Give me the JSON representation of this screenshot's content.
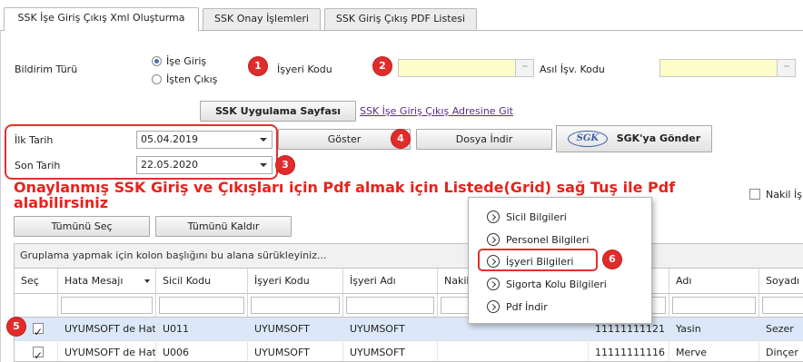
{
  "tabs": [
    {
      "label": "SSK İşe Giriş Çıkış Xml Oluşturma",
      "active": true
    },
    {
      "label": "SSK Onay İşlemleri",
      "active": false
    },
    {
      "label": "SSK Giriş Çıkış PDF Listesi",
      "active": false
    }
  ],
  "form": {
    "bildirim_label": "Bildirim Türü",
    "radio_ise_giris": "İşe Giriş",
    "radio_isten_cikis": "İşten Çıkış",
    "selected_radio": "İşe Giriş",
    "isyeri_kodu_label": "İşyeri Kodu",
    "isyeri_kodu_value": "",
    "asil_isv_label": "Asıl İşv. Kodu",
    "asil_isv_value": "",
    "lookup_glyph": "···",
    "ssk_uygulama_button": "SSK Uygulama Sayfası",
    "ssk_link": "SSK İşe Giriş Çıkış Adresine Git",
    "ilk_tarih_label": "İlk Tarih",
    "ilk_tarih_value": "05.04.2019",
    "son_tarih_label": "Son Tarih",
    "son_tarih_value": "22.05.2020",
    "goster_button": "Göster",
    "dosya_indir_button": "Dosya İndir",
    "sgk_logo_text": "SGK",
    "sgk_gonder_button": "SGK'ya Gönder",
    "nakil_label": "Nakil İş",
    "tumunu_sec_button": "Tümünü Seç",
    "tumunu_kaldir_button": "Tümünü Kaldır"
  },
  "annotation_text": "Onaylanmış SSK Giriş ve Çıkışları için Pdf almak için Listede(Grid) sağ Tuş ile Pdf alabilirsiniz",
  "badges": [
    "1",
    "2",
    "3",
    "4",
    "5",
    "6"
  ],
  "grid": {
    "group_panel_text": "Gruplama yapmak için kolon başlığını bu alana sürükleyiniz...",
    "columns": [
      "Seç",
      "Hata Mesajı",
      "Sicil Kodu",
      "İşyeri Kodu",
      "İşyeri Adı",
      "Nakil",
      "",
      "Adı",
      "Soyadı"
    ],
    "rows": [
      {
        "checked": true,
        "hata": "UYUMSOFT de Hat",
        "sicil": "U011",
        "isyeri_kodu": "UYUMSOFT",
        "isyeri_adi": "UYUMSOFT",
        "nakil": "",
        "tc": "11111111121",
        "adi": "Yasin",
        "soyadi": "Sezer",
        "selected": true
      },
      {
        "checked": true,
        "hata": "UYUMSOFT de Hat",
        "sicil": "U006",
        "isyeri_kodu": "UYUMSOFT",
        "isyeri_adi": "UYUMSOFT",
        "nakil": "",
        "tc": "11111111116",
        "adi": "Merve",
        "soyadi": "Dinçer",
        "selected": false
      }
    ]
  },
  "context_menu": [
    "Sicil Bilgileri",
    "Personel Bilgileri",
    "İşyeri Bilgileri",
    "Sigorta Kolu Bilgileri",
    "Pdf İndir"
  ],
  "colors": {
    "highlight_red": "#e22b2b",
    "yellow_field": "#fcfdc9",
    "selected_row": "#dce8f9",
    "link_purple": "#5a2a8a"
  }
}
